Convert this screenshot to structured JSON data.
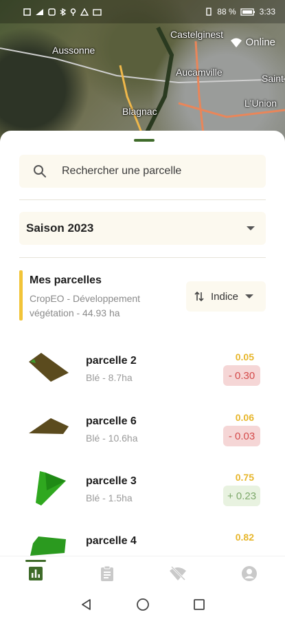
{
  "status_bar": {
    "battery": "88 %",
    "time": "3:33"
  },
  "map": {
    "towns": [
      "Aussonne",
      "Castelginest",
      "Aucamville",
      "Saint",
      "Blagnac",
      "L'Union"
    ],
    "connection_label": "Online"
  },
  "search": {
    "placeholder": "Rechercher une parcelle"
  },
  "season": {
    "selected": "Saison 2023"
  },
  "group": {
    "title": "Mes parcelles",
    "subtitle": "CropEO - Développement végétation - 44.93 ha",
    "sort_label": "Indice"
  },
  "parcels": [
    {
      "name": "parcelle 2",
      "detail": "Blé - 8.7ha",
      "index": "0.05",
      "delta": "- 0.30",
      "trend": "neg"
    },
    {
      "name": "parcelle 6",
      "detail": "Blé - 10.6ha",
      "index": "0.06",
      "delta": "- 0.03",
      "trend": "neg"
    },
    {
      "name": "parcelle 3",
      "detail": "Blé - 1.5ha",
      "index": "0.75",
      "delta": "+ 0.23",
      "trend": "pos"
    },
    {
      "name": "parcelle 4",
      "detail": "",
      "index": "0.82",
      "delta": "",
      "trend": "pos"
    }
  ],
  "bottom_nav": {
    "items": [
      "chart-icon",
      "clipboard-icon",
      "wifi-off-icon",
      "account-icon"
    ],
    "active": 0
  },
  "colors": {
    "accent": "#3f6b2a",
    "group_marker": "#f2c438",
    "index_value": "#e7b62b",
    "negative": "#d44a4a",
    "positive": "#7da86a"
  }
}
